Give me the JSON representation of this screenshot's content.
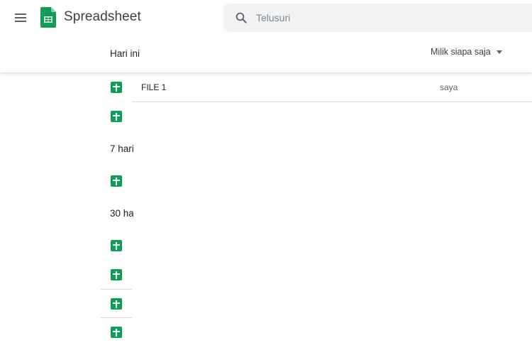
{
  "app": {
    "title": "Spreadsheet",
    "brand_color": "#0f9d58"
  },
  "search": {
    "placeholder": "Telusuri",
    "value": ""
  },
  "list_header": {
    "section": "Hari ini",
    "owner_filter": "Milik siapa saja"
  },
  "groups": [
    {
      "label": "Hari ini",
      "files": [
        {
          "name": "FILE 1",
          "owner": "saya"
        },
        {
          "name": "",
          "owner": ""
        }
      ]
    },
    {
      "label": "7 hari",
      "files": [
        {
          "name": "",
          "owner": ""
        }
      ]
    },
    {
      "label": "30 ha",
      "files": [
        {
          "name": "",
          "owner": ""
        },
        {
          "name": "",
          "owner": ""
        },
        {
          "name": "",
          "owner": ""
        },
        {
          "name": "",
          "owner": ""
        }
      ]
    }
  ],
  "icons": {
    "menu": "hamburger-menu-icon",
    "logo": "google-sheets-logo",
    "search": "magnifier-icon",
    "file": "sheets-file-icon",
    "dropdown": "caret-down-icon"
  }
}
